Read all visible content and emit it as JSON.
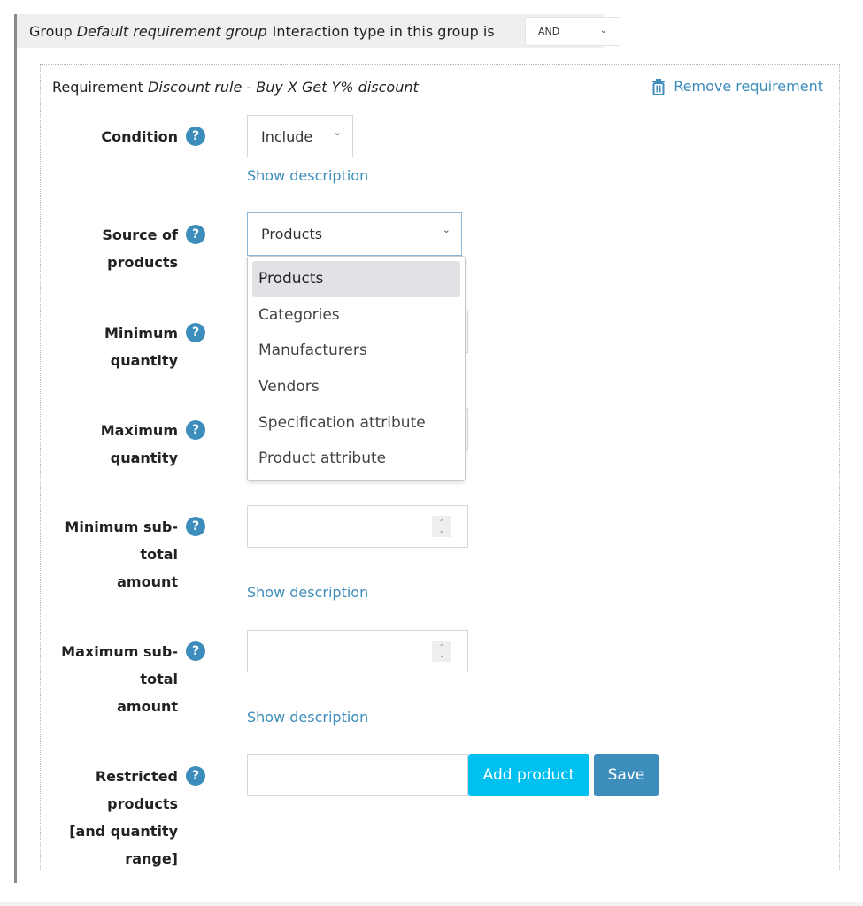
{
  "group": {
    "prefix": "Group",
    "name": "Default requirement group",
    "interaction_text": "Interaction type in this group is",
    "interaction_type": "AND"
  },
  "requirement": {
    "prefix": "Requirement",
    "name": "Discount rule - Buy X Get Y% discount",
    "remove_label": "Remove requirement"
  },
  "fields": {
    "condition": {
      "label": "Condition",
      "value": "Include",
      "show_description": "Show description"
    },
    "source_of_products": {
      "label": "Source of products",
      "value": "Products",
      "options": [
        "Products",
        "Categories",
        "Manufacturers",
        "Vendors",
        "Specification attribute",
        "Product attribute"
      ],
      "selected_index": 0
    },
    "minimum_quantity": {
      "label": "Minimum quantity",
      "value": ""
    },
    "maximum_quantity": {
      "label": "Maximum quantity",
      "value": ""
    },
    "minimum_subtotal": {
      "label_line1": "Minimum sub-total",
      "label_line2": "amount",
      "value": "",
      "show_description": "Show description"
    },
    "maximum_subtotal": {
      "label_line1": "Maximum sub-total",
      "label_line2": "amount",
      "value": "",
      "show_description": "Show description"
    },
    "restricted_products": {
      "label_line1": "Restricted products",
      "label_line2": "[and quantity",
      "label_line3": "range]",
      "value": "",
      "add_button": "Add product",
      "save_button": "Save"
    }
  },
  "icons": {
    "help": "?",
    "chevron": "⌄"
  },
  "colors": {
    "accent": "#3c8dbc",
    "add_button": "#00c0ef",
    "header_bg": "#efefef"
  }
}
